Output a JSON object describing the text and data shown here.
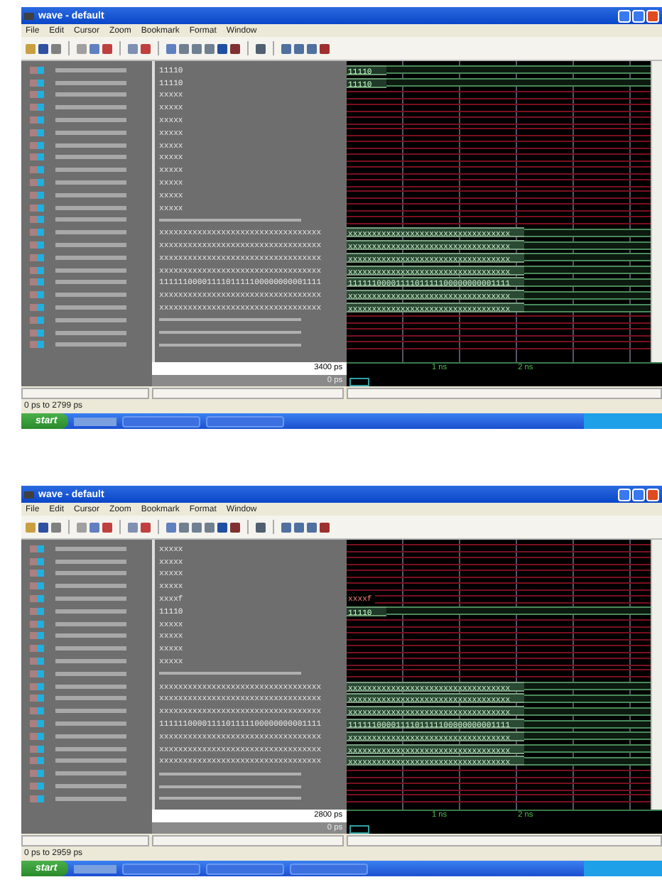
{
  "screenshots": [
    {
      "window": {
        "title": "wave - default"
      },
      "menu": [
        "File",
        "Edit",
        "Cursor",
        "Zoom",
        "Bookmark",
        "Format",
        "Window"
      ],
      "rows": [
        {
          "kind": "bus",
          "value": "11110",
          "wave_label": "11110"
        },
        {
          "kind": "bus",
          "value": "11110",
          "wave_label": "11110"
        },
        {
          "kind": "undef",
          "value": "xxxxx"
        },
        {
          "kind": "undef",
          "value": "xxxxx"
        },
        {
          "kind": "undef",
          "value": "xxxxx"
        },
        {
          "kind": "undef",
          "value": "xxxxx"
        },
        {
          "kind": "undef",
          "value": "xxxxx"
        },
        {
          "kind": "undef",
          "value": "xxxxx"
        },
        {
          "kind": "undef",
          "value": "xxxxx"
        },
        {
          "kind": "undef",
          "value": "xxxxx"
        },
        {
          "kind": "undef",
          "value": "xxxxx"
        },
        {
          "kind": "undef",
          "value": "xxxxx"
        },
        {
          "kind": "line"
        },
        {
          "kind": "hex",
          "value": "xxxxxxxxxxxxxxxxxxxxxxxxxxxxxxxxxx",
          "wave_label": "xxxxxxxxxxxxxxxxxxxxxxxxxxxxxxxxxx"
        },
        {
          "kind": "hex",
          "value": "xxxxxxxxxxxxxxxxxxxxxxxxxxxxxxxxxx",
          "wave_label": "xxxxxxxxxxxxxxxxxxxxxxxxxxxxxxxxxx"
        },
        {
          "kind": "hex",
          "value": "xxxxxxxxxxxxxxxxxxxxxxxxxxxxxxxxxx",
          "wave_label": "xxxxxxxxxxxxxxxxxxxxxxxxxxxxxxxxxx"
        },
        {
          "kind": "hex",
          "value": "xxxxxxxxxxxxxxxxxxxxxxxxxxxxxxxxxx",
          "wave_label": "xxxxxxxxxxxxxxxxxxxxxxxxxxxxxxxxxx"
        },
        {
          "kind": "hex",
          "value": "1111110000111101111100000000001111",
          "wave_label": "1111110000111101111100000000001111"
        },
        {
          "kind": "hex",
          "value": "xxxxxxxxxxxxxxxxxxxxxxxxxxxxxxxxxx",
          "wave_label": "xxxxxxxxxxxxxxxxxxxxxxxxxxxxxxxxxx"
        },
        {
          "kind": "hex",
          "value": "xxxxxxxxxxxxxxxxxxxxxxxxxxxxxxxxxx",
          "wave_label": "xxxxxxxxxxxxxxxxxxxxxxxxxxxxxxxxxx"
        },
        {
          "kind": "line"
        },
        {
          "kind": "line"
        },
        {
          "kind": "line"
        }
      ],
      "cursor": {
        "time": "3400 ps",
        "label": "0 ps"
      },
      "timeline": [
        "1 ns",
        "2 ns"
      ],
      "status_bar": "0 ps to 2799 ps",
      "taskbar": {
        "start": "start"
      }
    },
    {
      "window": {
        "title": "wave - default"
      },
      "menu": [
        "File",
        "Edit",
        "Cursor",
        "Zoom",
        "Bookmark",
        "Format",
        "Window"
      ],
      "rows": [
        {
          "kind": "undef",
          "value": "xxxxx"
        },
        {
          "kind": "undef",
          "value": "xxxxx"
        },
        {
          "kind": "undef",
          "value": "xxxxx"
        },
        {
          "kind": "undef",
          "value": "xxxxx"
        },
        {
          "kind": "undef",
          "value": "xxxxf",
          "wave_label": "xxxxf"
        },
        {
          "kind": "bus",
          "value": "11110",
          "wave_label": "11110"
        },
        {
          "kind": "undef",
          "value": "xxxxx"
        },
        {
          "kind": "undef",
          "value": "xxxxx"
        },
        {
          "kind": "undef",
          "value": "xxxxx"
        },
        {
          "kind": "undef",
          "value": "xxxxx"
        },
        {
          "kind": "line"
        },
        {
          "kind": "hex",
          "value": "xxxxxxxxxxxxxxxxxxxxxxxxxxxxxxxxxx",
          "wave_label": "xxxxxxxxxxxxxxxxxxxxxxxxxxxxxxxxxx"
        },
        {
          "kind": "hex",
          "value": "xxxxxxxxxxxxxxxxxxxxxxxxxxxxxxxxxx",
          "wave_label": "xxxxxxxxxxxxxxxxxxxxxxxxxxxxxxxxxx"
        },
        {
          "kind": "hex",
          "value": "xxxxxxxxxxxxxxxxxxxxxxxxxxxxxxxxxx",
          "wave_label": "xxxxxxxxxxxxxxxxxxxxxxxxxxxxxxxxxx"
        },
        {
          "kind": "hex",
          "value": "1111110000111101111100000000001111",
          "wave_label": "1111110000111101111100000000001111"
        },
        {
          "kind": "hex",
          "value": "xxxxxxxxxxxxxxxxxxxxxxxxxxxxxxxxxx",
          "wave_label": "xxxxxxxxxxxxxxxxxxxxxxxxxxxxxxxxxx"
        },
        {
          "kind": "hex",
          "value": "xxxxxxxxxxxxxxxxxxxxxxxxxxxxxxxxxx",
          "wave_label": "xxxxxxxxxxxxxxxxxxxxxxxxxxxxxxxxxx"
        },
        {
          "kind": "hex",
          "value": "xxxxxxxxxxxxxxxxxxxxxxxxxxxxxxxxxx",
          "wave_label": "xxxxxxxxxxxxxxxxxxxxxxxxxxxxxxxxxx"
        },
        {
          "kind": "line"
        },
        {
          "kind": "line"
        },
        {
          "kind": "line"
        }
      ],
      "cursor": {
        "time": "2800 ps",
        "label": "0 ps"
      },
      "timeline": [
        "1 ns",
        "2 ns"
      ],
      "status_bar": "0 ps to 2959 ps",
      "taskbar": {
        "start": "start"
      }
    }
  ]
}
